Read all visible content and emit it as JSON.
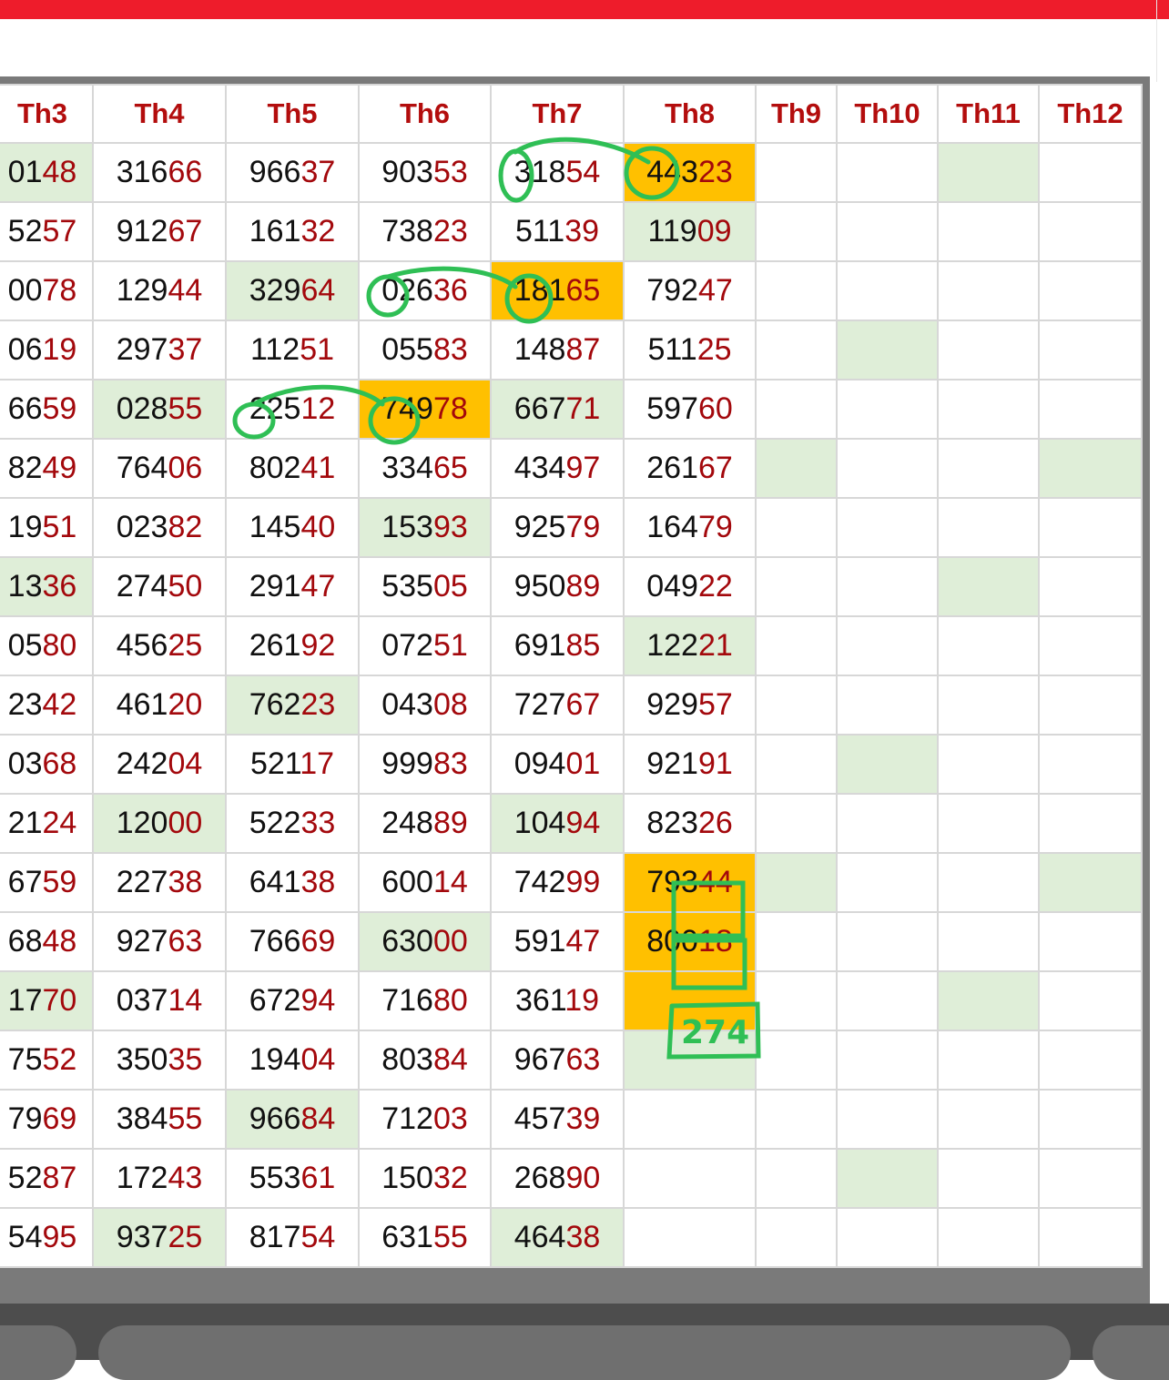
{
  "header_bar_color": "#ee1c2b",
  "columns": [
    "Th3",
    "Th4",
    "Th5",
    "Th6",
    "Th7",
    "Th8",
    "Th9",
    "Th10",
    "Th11",
    "Th12"
  ],
  "rows": [
    [
      "0148",
      "31666",
      "96637",
      "90353",
      "31854",
      "44323",
      "",
      "",
      "",
      ""
    ],
    [
      "5257",
      "91267",
      "16132",
      "73823",
      "51139",
      "11909",
      "",
      "",
      "",
      ""
    ],
    [
      "0078",
      "12944",
      "32964",
      "02636",
      "18165",
      "79247",
      "",
      "",
      "",
      ""
    ],
    [
      "0619",
      "29737",
      "11251",
      "05583",
      "14887",
      "51125",
      "",
      "",
      "",
      ""
    ],
    [
      "6659",
      "02855",
      "22512",
      "74978",
      "66771",
      "59760",
      "",
      "",
      "",
      ""
    ],
    [
      "8249",
      "76406",
      "80241",
      "33465",
      "43497",
      "26167",
      "",
      "",
      "",
      ""
    ],
    [
      "1951",
      "02382",
      "14540",
      "15393",
      "92579",
      "16479",
      "",
      "",
      "",
      ""
    ],
    [
      "1336",
      "27450",
      "29147",
      "53505",
      "95089",
      "04922",
      "",
      "",
      "",
      ""
    ],
    [
      "0580",
      "45625",
      "26192",
      "07251",
      "69185",
      "12221",
      "",
      "",
      "",
      ""
    ],
    [
      "2342",
      "46120",
      "76223",
      "04308",
      "72767",
      "92957",
      "",
      "",
      "",
      ""
    ],
    [
      "0368",
      "24204",
      "52117",
      "99983",
      "09401",
      "92191",
      "",
      "",
      "",
      ""
    ],
    [
      "2124",
      "12000",
      "52233",
      "24889",
      "10494",
      "82326",
      "",
      "",
      "",
      ""
    ],
    [
      "6759",
      "22738",
      "64138",
      "60014",
      "74299",
      "79344",
      "",
      "",
      "",
      ""
    ],
    [
      "6848",
      "92763",
      "76669",
      "63000",
      "59147",
      "80018",
      "",
      "",
      "",
      ""
    ],
    [
      "1770",
      "03714",
      "67294",
      "71680",
      "36119",
      "",
      "",
      "",
      "",
      ""
    ],
    [
      "7552",
      "35035",
      "19404",
      "80384",
      "96763",
      "",
      "",
      "",
      "",
      ""
    ],
    [
      "7969",
      "38455",
      "96684",
      "71203",
      "45739",
      "",
      "",
      "",
      "",
      ""
    ],
    [
      "5287",
      "17243",
      "55361",
      "15032",
      "26890",
      "",
      "",
      "",
      "",
      ""
    ],
    [
      "5495",
      "93725",
      "81754",
      "63155",
      "46438",
      "",
      "",
      "",
      "",
      ""
    ]
  ],
  "green_cells": [
    [
      0,
      0
    ],
    [
      0,
      8
    ],
    [
      1,
      5
    ],
    [
      2,
      2
    ],
    [
      3,
      7
    ],
    [
      4,
      1
    ],
    [
      4,
      4
    ],
    [
      5,
      6
    ],
    [
      5,
      9
    ],
    [
      6,
      3
    ],
    [
      7,
      0
    ],
    [
      7,
      8
    ],
    [
      8,
      5
    ],
    [
      9,
      2
    ],
    [
      10,
      7
    ],
    [
      11,
      1
    ],
    [
      11,
      4
    ],
    [
      12,
      6
    ],
    [
      12,
      9
    ],
    [
      13,
      3
    ],
    [
      14,
      0
    ],
    [
      14,
      8
    ],
    [
      15,
      5
    ],
    [
      16,
      2
    ],
    [
      17,
      7
    ],
    [
      18,
      1
    ],
    [
      18,
      4
    ]
  ],
  "orange_cells": [
    [
      0,
      5
    ],
    [
      2,
      4
    ],
    [
      4,
      3
    ],
    [
      12,
      5
    ],
    [
      13,
      5
    ],
    [
      14,
      5
    ]
  ],
  "handwritten_note": "274",
  "colors": {
    "green_highlight": "#dfeed8",
    "orange_highlight": "#ffc000",
    "header_text": "#b30d0d",
    "tail_digits": "#a3080c",
    "annotation_green": "#2fbf55"
  }
}
